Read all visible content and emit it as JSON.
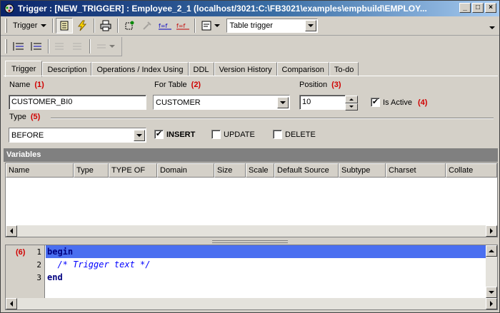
{
  "window": {
    "title": "Trigger : [NEW_TRIGGER] : Employee_2_1 (localhost/3021:C:\\FB3021\\examples\\empbuild\\EMPLOY...",
    "buttons": [
      "_",
      "□",
      "×"
    ]
  },
  "toolbar": {
    "trigger_menu_label": "Trigger",
    "trigger_type_value": "Table trigger",
    "icons": [
      "properties-icon",
      "compile-icon",
      "print-icon",
      "debug-icon",
      "tools-icon",
      "fields-icon",
      "fields-red-icon",
      "editor-icon"
    ]
  },
  "toolbar2": {
    "icons": [
      "indent-icon",
      "unindent-icon",
      "comment-icon",
      "uncomment-icon",
      "more-icon"
    ]
  },
  "tabs": [
    "Trigger",
    "Description",
    "Operations / Index Using",
    "DDL",
    "Version History",
    "Comparison",
    "To-do"
  ],
  "form": {
    "name_label": "Name",
    "name_marker": "(1)",
    "name_value": "CUSTOMER_BI0",
    "for_table_label": "For Table",
    "for_table_marker": "(2)",
    "for_table_value": "CUSTOMER",
    "position_label": "Position",
    "position_marker": "(3)",
    "position_value": "10",
    "is_active_label": "Is Active",
    "is_active_marker": "(4)",
    "is_active_checked": "✔",
    "type_label": "Type",
    "type_marker": "(5)",
    "type_value": "BEFORE",
    "insert_label": "INSERT",
    "insert_checked": "✔",
    "update_label": "UPDATE",
    "delete_label": "DELETE"
  },
  "variables": {
    "title": "Variables",
    "columns": [
      "Name",
      "Type",
      "TYPE OF",
      "Domain",
      "Size",
      "Scale",
      "Default Source",
      "Subtype",
      "Charset",
      "Collate"
    ]
  },
  "editor": {
    "marker": "(6)",
    "lines": [
      {
        "num": "1",
        "text": "begin"
      },
      {
        "num": "2",
        "text": "  /* Trigger text */"
      },
      {
        "num": "3",
        "text": "end"
      }
    ]
  }
}
